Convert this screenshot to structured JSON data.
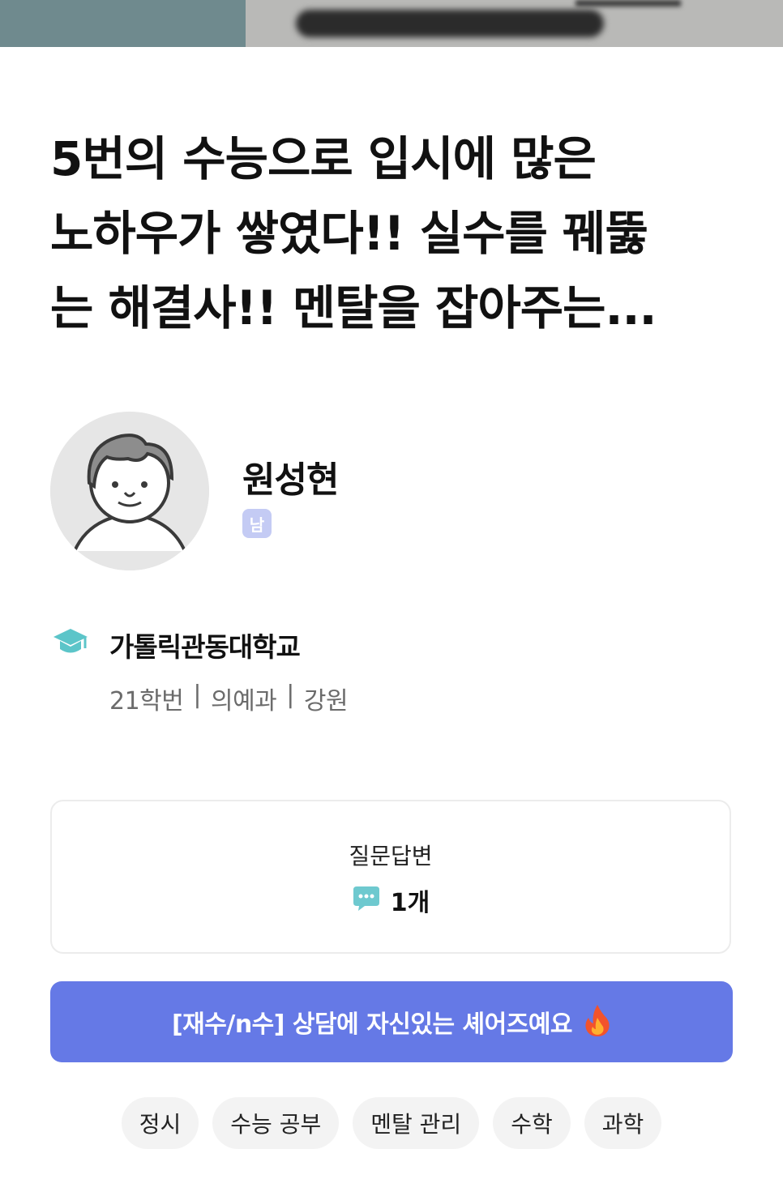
{
  "post": {
    "title": "5번의 수능으로 입시에 많은\n노하우가 쌓였다!! 실수를 꿰뚫\n는 해결사!! 멘탈을 잡아주는..."
  },
  "profile": {
    "name": "원성현",
    "gender": "남",
    "avatar_icon": "default-avatar-icon"
  },
  "school": {
    "icon": "graduation-cap-icon",
    "name": "가톨릭관동대학교",
    "admission_year": "21학번",
    "separator": "|",
    "major": "의예과",
    "region": "강원"
  },
  "stats": {
    "label": "질문답변",
    "icon": "chat-bubble-icon",
    "value": "1개"
  },
  "banner": {
    "text": "[재수/n수] 상담에 자신있는 셰어즈예요",
    "icon": "fire-icon",
    "background_color": "#6579e6"
  },
  "tags": [
    "정시",
    "수능 공부",
    "멘탈 관리",
    "수학",
    "과학"
  ]
}
